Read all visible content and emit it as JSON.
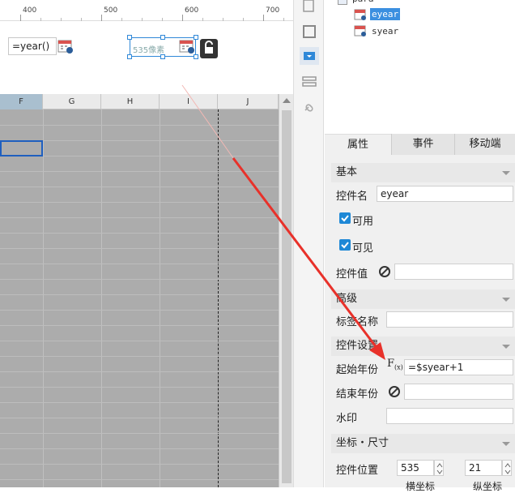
{
  "ruler": {
    "labels": [
      "400",
      "500",
      "600",
      "700"
    ]
  },
  "design": {
    "field1_value": "=year()",
    "size_label": "535像素"
  },
  "columns": [
    "F",
    "G",
    "H",
    "I",
    "J"
  ],
  "tree": {
    "root": "para",
    "items": [
      "eyear",
      "syear"
    ]
  },
  "tabs": [
    "属性",
    "事件",
    "移动端"
  ],
  "sections": {
    "basic": "基本",
    "advanced": "高级",
    "widget_settings": "控件设置",
    "position_size": "坐标・尺寸"
  },
  "props": {
    "widget_name_label": "控件名",
    "widget_name_value": "eyear",
    "enabled_label": "可用",
    "visible_label": "可见",
    "widget_value_label": "控件值",
    "tag_name_label": "标签名称",
    "start_year_label": "起始年份",
    "start_year_value": "=$syear+1",
    "end_year_label": "结束年份",
    "watermark_label": "水印",
    "position_label": "控件位置",
    "x_value": "535",
    "y_value": "21",
    "x_caption": "横坐标",
    "y_caption": "纵坐标"
  },
  "colors": {
    "accent": "#2f88d8",
    "selected_tree": "#3b8fe0",
    "arrow": "#e8312a"
  }
}
